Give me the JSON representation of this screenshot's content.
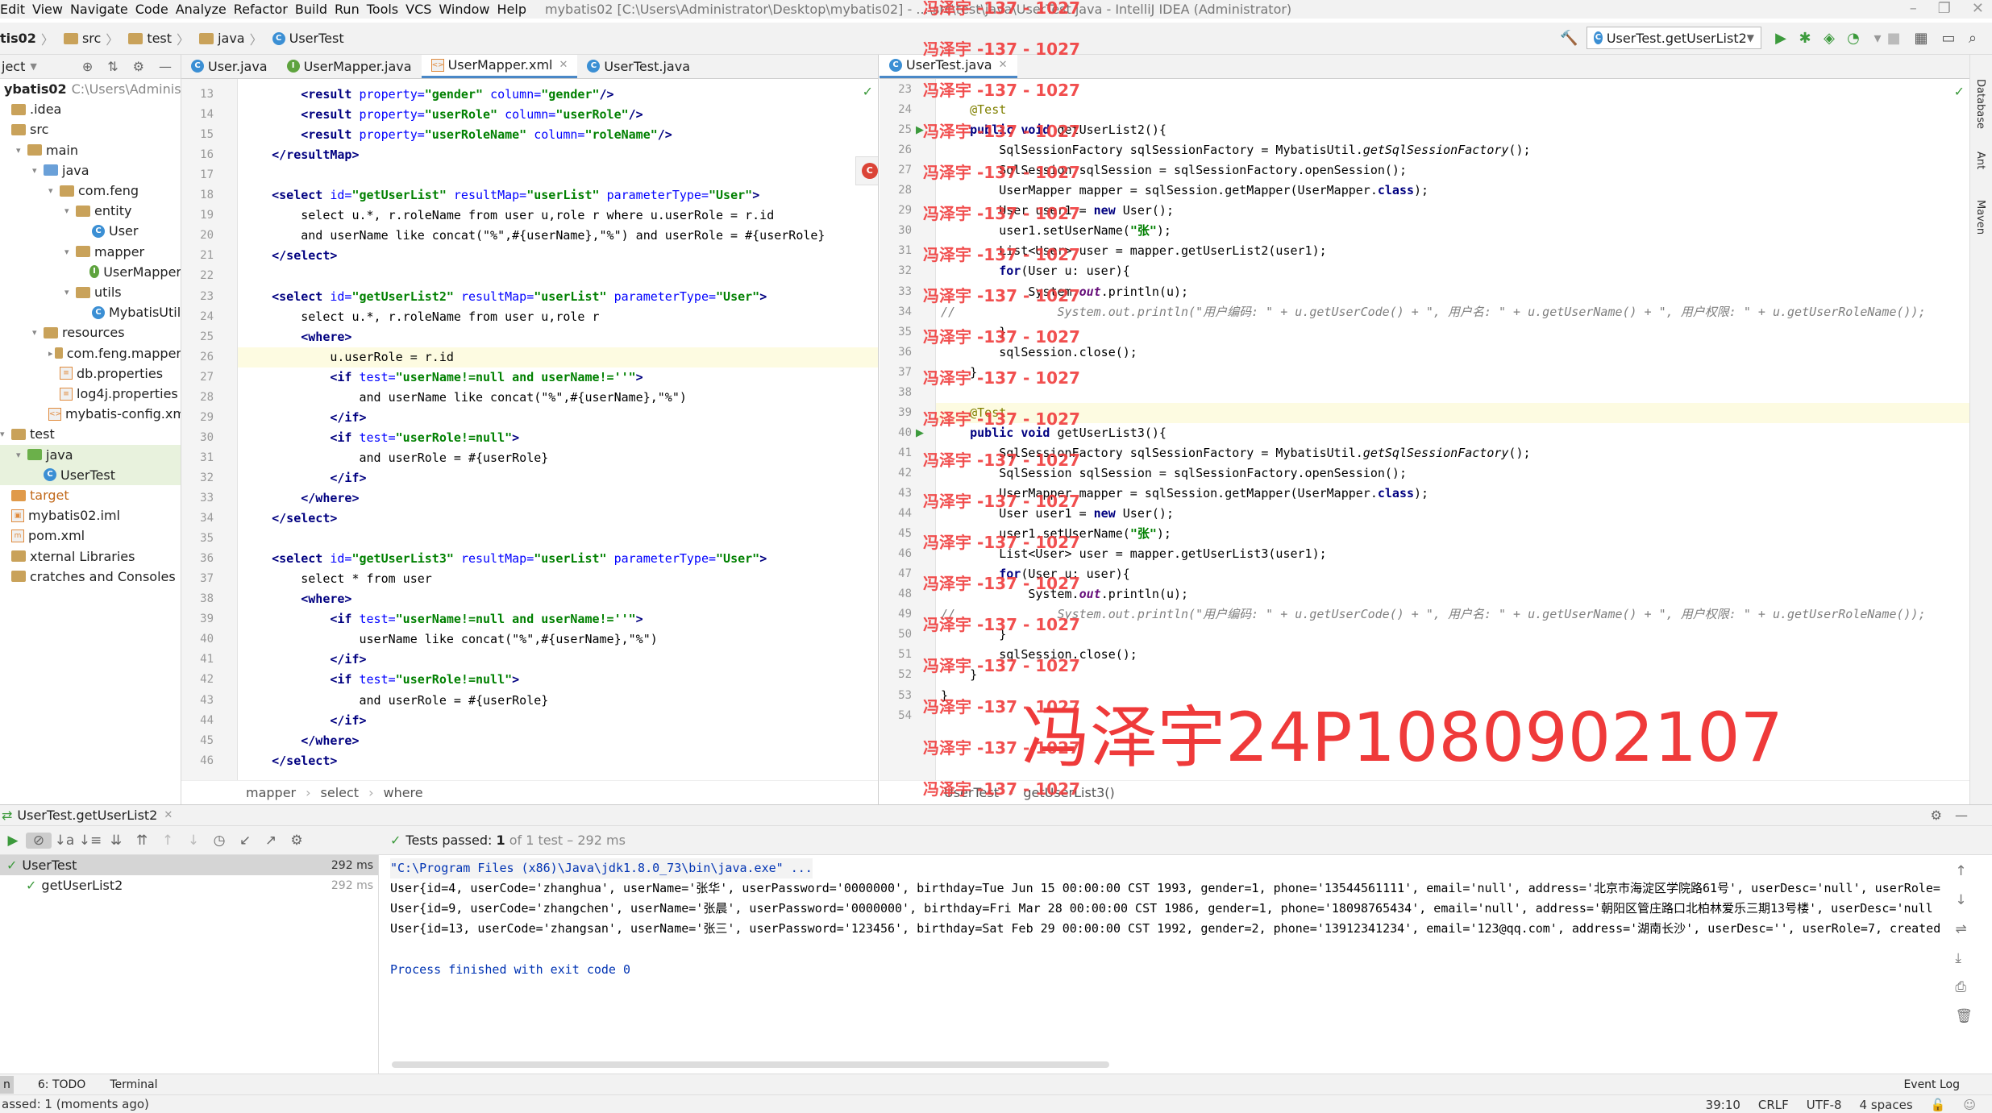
{
  "menu": {
    "items": [
      "Edit",
      "View",
      "Navigate",
      "Code",
      "Analyze",
      "Refactor",
      "Build",
      "Run",
      "Tools",
      "VCS",
      "Window",
      "Help"
    ],
    "title": "mybatis02 [C:\\Users\\Administrator\\Desktop\\mybatis02] - ...\\src\\test\\java\\UserTest.java - IntelliJ IDEA (Administrator)"
  },
  "nav": {
    "crumbs": [
      "tis02",
      "src",
      "test",
      "java",
      "UserTest"
    ],
    "run_config": "UserTest.getUserList2"
  },
  "project": {
    "header": "ject",
    "rows": [
      {
        "label": "ybatis02",
        "extra": "C:\\Users\\Administrat",
        "indent": 0,
        "icon": "folder",
        "bold": true
      },
      {
        "label": ".idea",
        "indent": 0,
        "icon": "folder"
      },
      {
        "label": "src",
        "indent": 0,
        "icon": "folder"
      },
      {
        "label": "main",
        "indent": 1,
        "icon": "folder",
        "open": true
      },
      {
        "label": "java",
        "indent": 2,
        "icon": "folder-src",
        "open": true
      },
      {
        "label": "com.feng",
        "indent": 3,
        "icon": "folder",
        "open": true
      },
      {
        "label": "entity",
        "indent": 4,
        "icon": "folder",
        "open": true
      },
      {
        "label": "User",
        "indent": 5,
        "icon": "class"
      },
      {
        "label": "mapper",
        "indent": 4,
        "icon": "folder",
        "open": true
      },
      {
        "label": "UserMapper",
        "indent": 5,
        "icon": "interface"
      },
      {
        "label": "utils",
        "indent": 4,
        "icon": "folder",
        "open": true
      },
      {
        "label": "MybatisUtil",
        "indent": 5,
        "icon": "class"
      },
      {
        "label": "resources",
        "indent": 2,
        "icon": "folder-res",
        "open": true
      },
      {
        "label": "com.feng.mapper",
        "indent": 3,
        "icon": "folder",
        "closed": true
      },
      {
        "label": "db.properties",
        "indent": 3,
        "icon": "props"
      },
      {
        "label": "log4j.properties",
        "indent": 3,
        "icon": "props"
      },
      {
        "label": "mybatis-config.xml",
        "indent": 3,
        "icon": "xml"
      },
      {
        "label": "test",
        "indent": 0,
        "icon": "folder",
        "open": true
      },
      {
        "label": "java",
        "indent": 1,
        "icon": "folder-test",
        "open": true,
        "sel": true
      },
      {
        "label": "UserTest",
        "indent": 2,
        "icon": "class",
        "sel": true
      },
      {
        "label": "target",
        "indent": 0,
        "icon": "folder-target"
      },
      {
        "label": "mybatis02.iml",
        "indent": 0,
        "icon": "iml"
      },
      {
        "label": "pom.xml",
        "indent": 0,
        "icon": "maven"
      },
      {
        "label": "xternal Libraries",
        "indent": 0,
        "icon": "lib"
      },
      {
        "label": "cratches and Consoles",
        "indent": 0,
        "icon": "scratch"
      }
    ]
  },
  "left_editor": {
    "tabs": [
      {
        "label": "User.java",
        "icon": "class"
      },
      {
        "label": "UserMapper.java",
        "icon": "interface"
      },
      {
        "label": "UserMapper.xml",
        "icon": "xml",
        "active": true
      },
      {
        "label": "UserTest.java",
        "icon": "class"
      }
    ],
    "lines": [
      {
        "n": "13",
        "html": "        <span class=\"tag\">&lt;result </span><span class=\"attr\">property=</span><span class=\"val\">\"gender\"</span> <span class=\"attr\">column=</span><span class=\"val\">\"gender\"</span><span class=\"tag\">/&gt;</span>"
      },
      {
        "n": "14",
        "html": "        <span class=\"tag\">&lt;result </span><span class=\"attr\">property=</span><span class=\"val\">\"userRole\"</span> <span class=\"attr\">column=</span><span class=\"val\">\"userRole\"</span><span class=\"tag\">/&gt;</span>"
      },
      {
        "n": "15",
        "html": "        <span class=\"tag\">&lt;result </span><span class=\"attr\">property=</span><span class=\"val\">\"userRoleName\"</span> <span class=\"attr\">column=</span><span class=\"val\">\"roleName\"</span><span class=\"tag\">/&gt;</span>"
      },
      {
        "n": "16",
        "html": "    <span class=\"tag\">&lt;/resultMap&gt;</span>"
      },
      {
        "n": "17",
        "html": ""
      },
      {
        "n": "18",
        "html": "    <span class=\"tag\">&lt;select </span><span class=\"attr\">id=</span><span class=\"val\">\"getUserList\"</span> <span class=\"attr\">resultMap=</span><span class=\"val\">\"userList\"</span> <span class=\"attr\">parameterType=</span><span class=\"val\">\"User\"</span><span class=\"tag\">&gt;</span>"
      },
      {
        "n": "19",
        "html": "        select u.*, r.roleName from user u,role r where u.userRole = r.id"
      },
      {
        "n": "20",
        "html": "        and userName like concat(\"%\",#{userName},\"%\") and userRole = #{userRole}"
      },
      {
        "n": "21",
        "html": "    <span class=\"tag\">&lt;/select&gt;</span>"
      },
      {
        "n": "22",
        "html": ""
      },
      {
        "n": "23",
        "html": "    <span class=\"tag\">&lt;select </span><span class=\"attr\">id=</span><span class=\"val\">\"getUserList2\"</span> <span class=\"attr\">resultMap=</span><span class=\"val\">\"userList\"</span> <span class=\"attr\">parameterType=</span><span class=\"val\">\"User\"</span><span class=\"tag\">&gt;</span>"
      },
      {
        "n": "24",
        "html": "        select u.*, r.roleName from user u,role r"
      },
      {
        "n": "25",
        "html": "        <span class=\"tag\">&lt;where&gt;</span>"
      },
      {
        "n": "26",
        "html": "            u.userRole = r.id",
        "hl": true
      },
      {
        "n": "27",
        "html": "            <span class=\"tag\">&lt;if </span><span class=\"attr\">test=</span><span class=\"val\">\"userName!=null and userName!=''\"</span><span class=\"tag\">&gt;</span>"
      },
      {
        "n": "28",
        "html": "                and userName like concat(\"%\",#{userName},\"%\")"
      },
      {
        "n": "29",
        "html": "            <span class=\"tag\">&lt;/if&gt;</span>"
      },
      {
        "n": "30",
        "html": "            <span class=\"tag\">&lt;if </span><span class=\"attr\">test=</span><span class=\"val\">\"userRole!=null\"</span><span class=\"tag\">&gt;</span>"
      },
      {
        "n": "31",
        "html": "                and userRole = #{userRole}"
      },
      {
        "n": "32",
        "html": "            <span class=\"tag\">&lt;/if&gt;</span>"
      },
      {
        "n": "33",
        "html": "        <span class=\"tag\">&lt;/where&gt;</span>"
      },
      {
        "n": "34",
        "html": "    <span class=\"tag\">&lt;/select&gt;</span>"
      },
      {
        "n": "35",
        "html": ""
      },
      {
        "n": "36",
        "html": "    <span class=\"tag\">&lt;select </span><span class=\"attr\">id=</span><span class=\"val\">\"getUserList3\"</span> <span class=\"attr\">resultMap=</span><span class=\"val\">\"userList\"</span> <span class=\"attr\">parameterType=</span><span class=\"val\">\"User\"</span><span class=\"tag\">&gt;</span>"
      },
      {
        "n": "37",
        "html": "        select * from user"
      },
      {
        "n": "38",
        "html": "        <span class=\"tag\">&lt;where&gt;</span>"
      },
      {
        "n": "39",
        "html": "            <span class=\"tag\">&lt;if </span><span class=\"attr\">test=</span><span class=\"val\">\"userName!=null and userName!=''\"</span><span class=\"tag\">&gt;</span>"
      },
      {
        "n": "40",
        "html": "                userName like concat(\"%\",#{userName},\"%\")"
      },
      {
        "n": "41",
        "html": "            <span class=\"tag\">&lt;/if&gt;</span>"
      },
      {
        "n": "42",
        "html": "            <span class=\"tag\">&lt;if </span><span class=\"attr\">test=</span><span class=\"val\">\"userRole!=null\"</span><span class=\"tag\">&gt;</span>"
      },
      {
        "n": "43",
        "html": "                and userRole = #{userRole}"
      },
      {
        "n": "44",
        "html": "            <span class=\"tag\">&lt;/if&gt;</span>"
      },
      {
        "n": "45",
        "html": "        <span class=\"tag\">&lt;/where&gt;</span>"
      },
      {
        "n": "46",
        "html": "    <span class=\"tag\">&lt;/select&gt;</span>"
      }
    ],
    "breadcrumb": [
      "mapper",
      "select",
      "where"
    ]
  },
  "right_editor": {
    "tabs": [
      {
        "label": "UserTest.java",
        "icon": "class",
        "active": true
      }
    ],
    "lines": [
      {
        "n": "23",
        "html": ""
      },
      {
        "n": "24",
        "html": "    <span class=\"ann\">@Test</span>"
      },
      {
        "n": "25",
        "html": "    <span class=\"kw\">public void</span> getUserList2(){",
        "run": true
      },
      {
        "n": "26",
        "html": "        SqlSessionFactory sqlSessionFactory = MybatisUtil.<span class=\"italic\">getSqlSessionFactory</span>();"
      },
      {
        "n": "27",
        "html": "        SqlSession sqlSession = sqlSessionFactory.openSession();"
      },
      {
        "n": "28",
        "html": "        UserMapper mapper = sqlSession.getMapper(UserMapper.<span class=\"kw\">class</span>);"
      },
      {
        "n": "29",
        "html": "        User user1 = <span class=\"kw\">new</span> User();"
      },
      {
        "n": "30",
        "html": "        user1.setUserName(<span class=\"str\">\"张\"</span>);"
      },
      {
        "n": "31",
        "html": "        List&lt;User&gt; user = mapper.getUserList2(user1);"
      },
      {
        "n": "32",
        "html": "        <span class=\"kw\">for</span>(User u: user){"
      },
      {
        "n": "33",
        "html": "            System.<span class=\"field\">out</span>.println(u);"
      },
      {
        "n": "34",
        "html": "<span class=\"cmt\">//              System.out.println(\"用户编码: \" + u.getUserCode() + \", 用户名: \" + u.getUserName() + \", 用户权限: \" + u.getUserRoleName());</span>"
      },
      {
        "n": "35",
        "html": "        }"
      },
      {
        "n": "36",
        "html": "        sqlSession.close();"
      },
      {
        "n": "37",
        "html": "    }"
      },
      {
        "n": "38",
        "html": ""
      },
      {
        "n": "39",
        "html": "    <span class=\"ann\">@Test</span>",
        "hl": true
      },
      {
        "n": "40",
        "html": "    <span class=\"kw\">public void</span> getUserList3(){",
        "run": true
      },
      {
        "n": "41",
        "html": "        SqlSessionFactory sqlSessionFactory = MybatisUtil.<span class=\"italic\">getSqlSessionFactory</span>();"
      },
      {
        "n": "42",
        "html": "        SqlSession sqlSession = sqlSessionFactory.openSession();"
      },
      {
        "n": "43",
        "html": "        UserMapper mapper = sqlSession.getMapper(UserMapper.<span class=\"kw\">class</span>);"
      },
      {
        "n": "44",
        "html": "        User user1 = <span class=\"kw\">new</span> User();"
      },
      {
        "n": "45",
        "html": "        user1.setUserName(<span class=\"str\">\"张\"</span>);"
      },
      {
        "n": "46",
        "html": "        List&lt;User&gt; user = mapper.getUserList3(user1);"
      },
      {
        "n": "47",
        "html": "        <span class=\"kw\">for</span>(User u: user){"
      },
      {
        "n": "48",
        "html": "            System.<span class=\"field\">out</span>.println(u);"
      },
      {
        "n": "49",
        "html": "<span class=\"cmt\">//              System.out.println(\"用户编码: \" + u.getUserCode() + \", 用户名: \" + u.getUserName() + \", 用户权限: \" + u.getUserRoleName());</span>"
      },
      {
        "n": "50",
        "html": "        }"
      },
      {
        "n": "51",
        "html": "        sqlSession.close();"
      },
      {
        "n": "52",
        "html": "    }"
      },
      {
        "n": "53",
        "html": "}"
      },
      {
        "n": "54",
        "html": ""
      }
    ],
    "breadcrumb": [
      "UserTest",
      "getUserList3()"
    ]
  },
  "watermark": {
    "small": "冯泽宇 -137 - 1027",
    "big": "冯泽宇24P1080902107"
  },
  "right_sidebar": [
    "Database",
    "Ant",
    "Maven"
  ],
  "run_panel": {
    "tab": "UserTest.getUserList2",
    "status_prefix": "Tests passed:",
    "status_count": "1",
    "status_suffix": "of 1 test – 292 ms",
    "tree": [
      {
        "label": "UserTest",
        "time": "292 ms",
        "indent": 0
      },
      {
        "label": "getUserList2",
        "time": "292 ms",
        "indent": 1
      }
    ],
    "console": [
      {
        "text": "\"C:\\Program Files (x86)\\Java\\jdk1.8.0_73\\bin\\java.exe\" ...",
        "cls": "path"
      },
      {
        "text": "User{id=4, userCode='zhanghua', userName='张华', userPassword='0000000', birthday=Tue Jun 15 00:00:00 CST 1993, gender=1, phone='13544561111', email='null', address='北京市海淀区学院路61号', userDesc='null', userRole=",
        "cls": ""
      },
      {
        "text": "User{id=9, userCode='zhangchen', userName='张晨', userPassword='0000000', birthday=Fri Mar 28 00:00:00 CST 1986, gender=1, phone='18098765434', email='null', address='朝阳区管庄路口北柏林爱乐三期13号楼', userDesc='null",
        "cls": ""
      },
      {
        "text": "User{id=13, userCode='zhangsan', userName='张三', userPassword='123456', birthday=Sat Feb 29 00:00:00 CST 1992, gender=2, phone='13912341234', email='123@qq.com', address='湖南长沙', userDesc='', userRole=7, created",
        "cls": ""
      },
      {
        "text": "",
        "cls": ""
      },
      {
        "text": "Process finished with exit code 0",
        "cls": "exit"
      }
    ]
  },
  "toolstrip": [
    "n",
    "6: TODO",
    "Terminal"
  ],
  "status_bar": {
    "left": "assed: 1 (moments ago)",
    "position": "39:10",
    "line_sep": "CRLF",
    "encoding": "UTF-8",
    "indent": "4 spaces",
    "event_log": "Event Log"
  }
}
